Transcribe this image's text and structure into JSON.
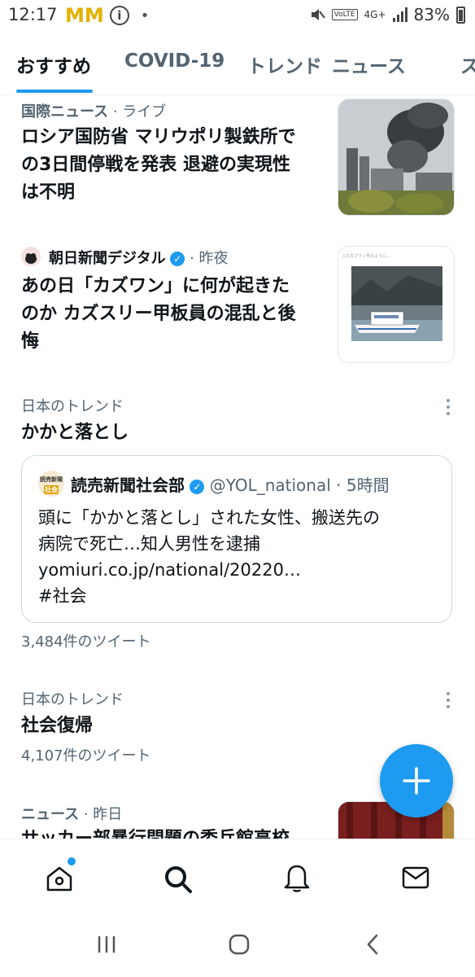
{
  "status_bar": {
    "time": "12:17",
    "mcdonalds_icons": "MM",
    "network": "4G+",
    "volte": "VoLTE",
    "battery": "83%"
  },
  "tabs": [
    {
      "label": "おすすめ",
      "active": true
    },
    {
      "label": "COVID-19",
      "active": false
    },
    {
      "label": "トレンド",
      "active": false
    },
    {
      "label": "ニュース",
      "active": false
    },
    {
      "label": "ス",
      "active": false
    }
  ],
  "items": {
    "news1": {
      "source": "国際ニュース",
      "meta": " · ライブ",
      "line1": "ロシア国防省 マリウポリ製鉄所で",
      "line2": "の3日間停戦を発表 退避の実現性",
      "line3": "は不明"
    },
    "news2": {
      "source": "朝日新聞デジタル",
      "meta": " · 昨夜",
      "line1": "あの日「カズワン」に何が起きた",
      "line2": "のか カズスリー甲板員の混乱と後",
      "line3": "悔",
      "thumb_caption": "このカズワン号のように..."
    },
    "trend1": {
      "context": "日本のトレンド",
      "title": "かかと落とし",
      "quote": {
        "name": "読売新聞社会部",
        "handle": "@YOL_national",
        "time": " · 5時間",
        "avatar_text_top": "読売新聞",
        "avatar_text_bottom": "社会",
        "line1": "頭に「かかと落とし」された女性、搬送先の",
        "line2": "病院で死亡…知人男性を逮捕",
        "line3": "yomiuri.co.jp/national/20220…",
        "line4": "#社会"
      },
      "count": "3,484件のツイート"
    },
    "trend2": {
      "context": "日本のトレンド",
      "title": "社会復帰",
      "count": "4,107件のツイート"
    },
    "news3": {
      "source": "ニュース",
      "meta": " · 昨日",
      "line1": "サッカー部暴行問題の委兵館高校"
    }
  },
  "colors": {
    "accent": "#1d9bf0",
    "text": "#0f1419",
    "secondary": "#536471"
  },
  "icons": {
    "bottom_nav": [
      "home-icon",
      "search-icon",
      "bell-icon",
      "mail-icon"
    ],
    "system_nav": [
      "recents-icon",
      "home-circle-icon",
      "back-icon"
    ]
  }
}
